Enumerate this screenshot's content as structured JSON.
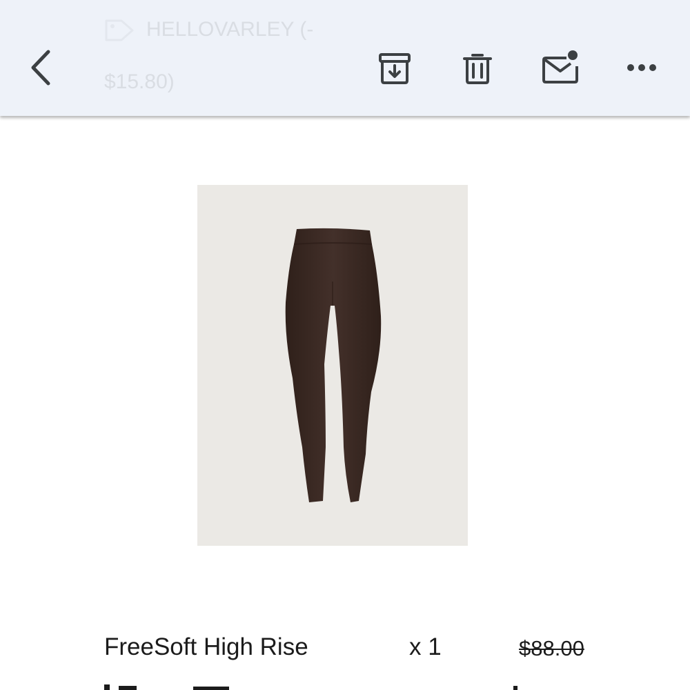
{
  "toolbar": {
    "sender_line1": "HELLOVARLEY (-",
    "sender_line2": "$15.80)",
    "buttons": {
      "back": "back-arrow-icon",
      "archive": "archive-icon",
      "delete": "trash-icon",
      "mark_unread": "mail-unread-icon",
      "more": "more-options-icon"
    }
  },
  "product": {
    "image_icon": "leggings-product-image",
    "name": "FreeSoft High Rise",
    "quantity": "x 1",
    "price": "$88.00"
  },
  "colors": {
    "toolbar_bg": "#eef2f9",
    "icon": "#3c4043",
    "image_bg": "#ebe9e5",
    "leggings": "#3d2a23"
  }
}
